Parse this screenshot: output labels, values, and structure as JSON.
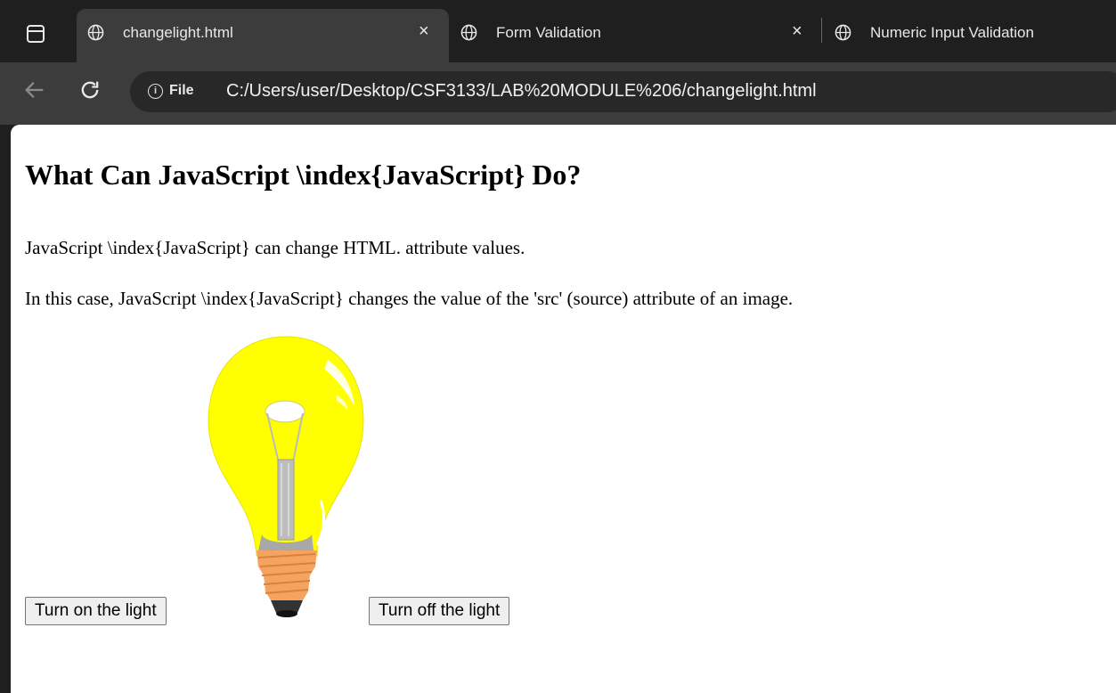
{
  "browser": {
    "tabs": [
      {
        "title": "changelight.html",
        "active": true
      },
      {
        "title": "Form Validation",
        "active": false
      },
      {
        "title": "Numeric Input Validation",
        "active": false
      }
    ],
    "close_glyph": "×",
    "address": {
      "security_label": "File",
      "url": "C:/Users/user/Desktop/CSF3133/LAB%20MODULE%206/changelight.html"
    }
  },
  "page": {
    "heading": "What Can JavaScript \\index{JavaScript} Do?",
    "para1": "JavaScript \\index{JavaScript} can change HTML. attribute values.",
    "para2": "In this case, JavaScript \\index{JavaScript} changes the value of the 'src' (source) attribute of an image.",
    "buttons": {
      "on": "Turn on the light",
      "off": "Turn off the light"
    }
  },
  "colors": {
    "bulb_on": "#ffff00",
    "base": "#f4a460"
  }
}
